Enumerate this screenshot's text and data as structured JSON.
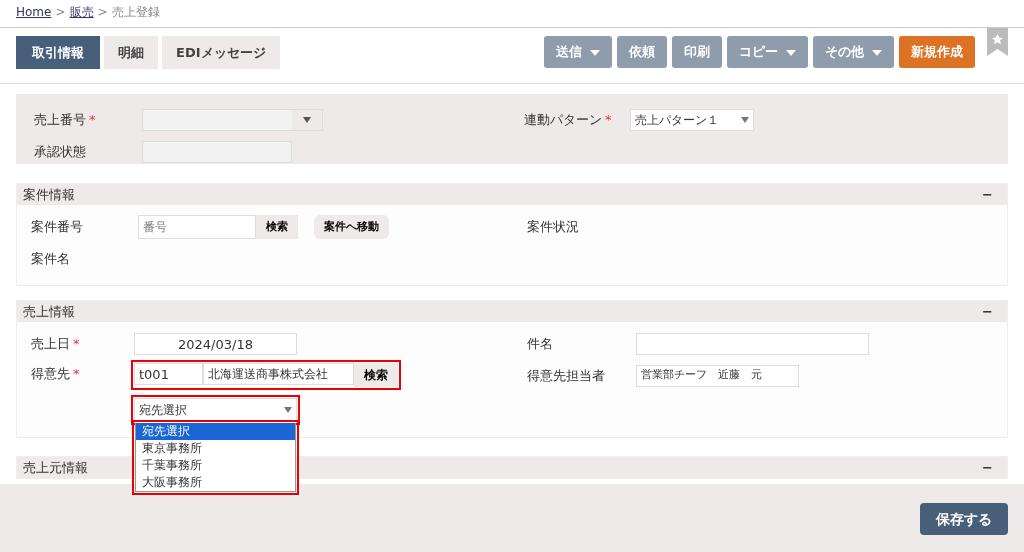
{
  "breadcrumb": [
    {
      "label": "Home",
      "link": true
    },
    {
      "label": "販売",
      "link": true
    },
    {
      "label": "売上登録",
      "link": false
    }
  ],
  "breadcrumb_separator": ">",
  "required_mark": "*",
  "tabs": [
    {
      "label": "取引情報",
      "selected": true
    },
    {
      "label": "明細",
      "selected": false
    },
    {
      "label": "EDIメッセージ",
      "selected": false
    }
  ],
  "toolbar": [
    {
      "label": "送信",
      "dropdown": true,
      "disabled": true,
      "primary": false
    },
    {
      "label": "依頼",
      "dropdown": false,
      "disabled": true,
      "primary": false
    },
    {
      "label": "印刷",
      "dropdown": false,
      "disabled": true,
      "primary": false
    },
    {
      "label": "コピー",
      "dropdown": true,
      "disabled": true,
      "primary": false
    },
    {
      "label": "その他",
      "dropdown": true,
      "disabled": true,
      "primary": false
    },
    {
      "label": "新規作成",
      "dropdown": false,
      "disabled": false,
      "primary": true
    }
  ],
  "header": {
    "left": [
      {
        "label": "売上番号",
        "required": true,
        "kind": "combo"
      },
      {
        "label": "承認状態",
        "required": false,
        "kind": "readonly"
      }
    ],
    "right": [
      {
        "label": "連動パターン",
        "required": true,
        "kind": "select",
        "value": "売上パターン１"
      }
    ]
  },
  "sections": [
    {
      "title": "案件情報",
      "toggle": "−",
      "left": [
        {
          "label": "案件番号",
          "required": false,
          "kind": "search",
          "placeholder": "番号",
          "button": "検索",
          "extra_button": "案件へ移動"
        },
        {
          "label": "案件名",
          "required": false,
          "kind": "text_only"
        }
      ],
      "right": [
        {
          "label": "案件状況",
          "required": false,
          "kind": "text_only"
        }
      ]
    },
    {
      "title": "売上情報",
      "toggle": "−",
      "left": [
        {
          "label": "売上日",
          "required": true,
          "kind": "date",
          "value": "2024/03/18"
        },
        {
          "label": "得意先",
          "required": true,
          "kind": "customer",
          "code": "t001",
          "name": "北海運送商事株式会社",
          "button": "検索",
          "highlighted": true,
          "dropdown": {
            "value": "宛先選択",
            "highlighted": true,
            "open": true,
            "options": [
              {
                "label": "宛先選択",
                "selected": true
              },
              {
                "label": "東京事務所",
                "selected": false
              },
              {
                "label": "千葉事務所",
                "selected": false
              },
              {
                "label": "大阪事務所",
                "selected": false
              }
            ]
          }
        }
      ],
      "right": [
        {
          "label": "件名",
          "required": false,
          "kind": "text"
        },
        {
          "label": "得意先担当者",
          "required": false,
          "kind": "short_text",
          "value": "営業部チーフ　近藤　元"
        }
      ]
    },
    {
      "title": "売上元情報",
      "toggle": "−"
    }
  ],
  "save_button": "保存する"
}
